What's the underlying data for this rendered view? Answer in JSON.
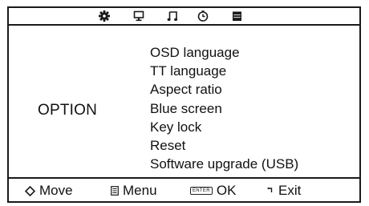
{
  "top_tabs": [
    {
      "icon": "gear-icon",
      "label": ""
    },
    {
      "icon": "monitor-icon",
      "label": ""
    },
    {
      "icon": "music-note-icon",
      "label": ""
    },
    {
      "icon": "clock-icon",
      "label": ""
    },
    {
      "icon": "option-block-icon",
      "label": "",
      "selected": true
    }
  ],
  "main": {
    "section_title": "OPTION",
    "items": [
      "OSD language",
      "TT language",
      "Aspect ratio",
      "Blue screen",
      "Key lock",
      "Reset",
      "Software upgrade (USB)"
    ]
  },
  "footer": {
    "move_label": "Move",
    "menu_label": "Menu",
    "enter_key_label": "ENTER",
    "ok_label": "OK",
    "exit_label": "Exit"
  },
  "colors": {
    "line": "#1a1a1a",
    "text": "#111111",
    "background": "#ffffff"
  }
}
